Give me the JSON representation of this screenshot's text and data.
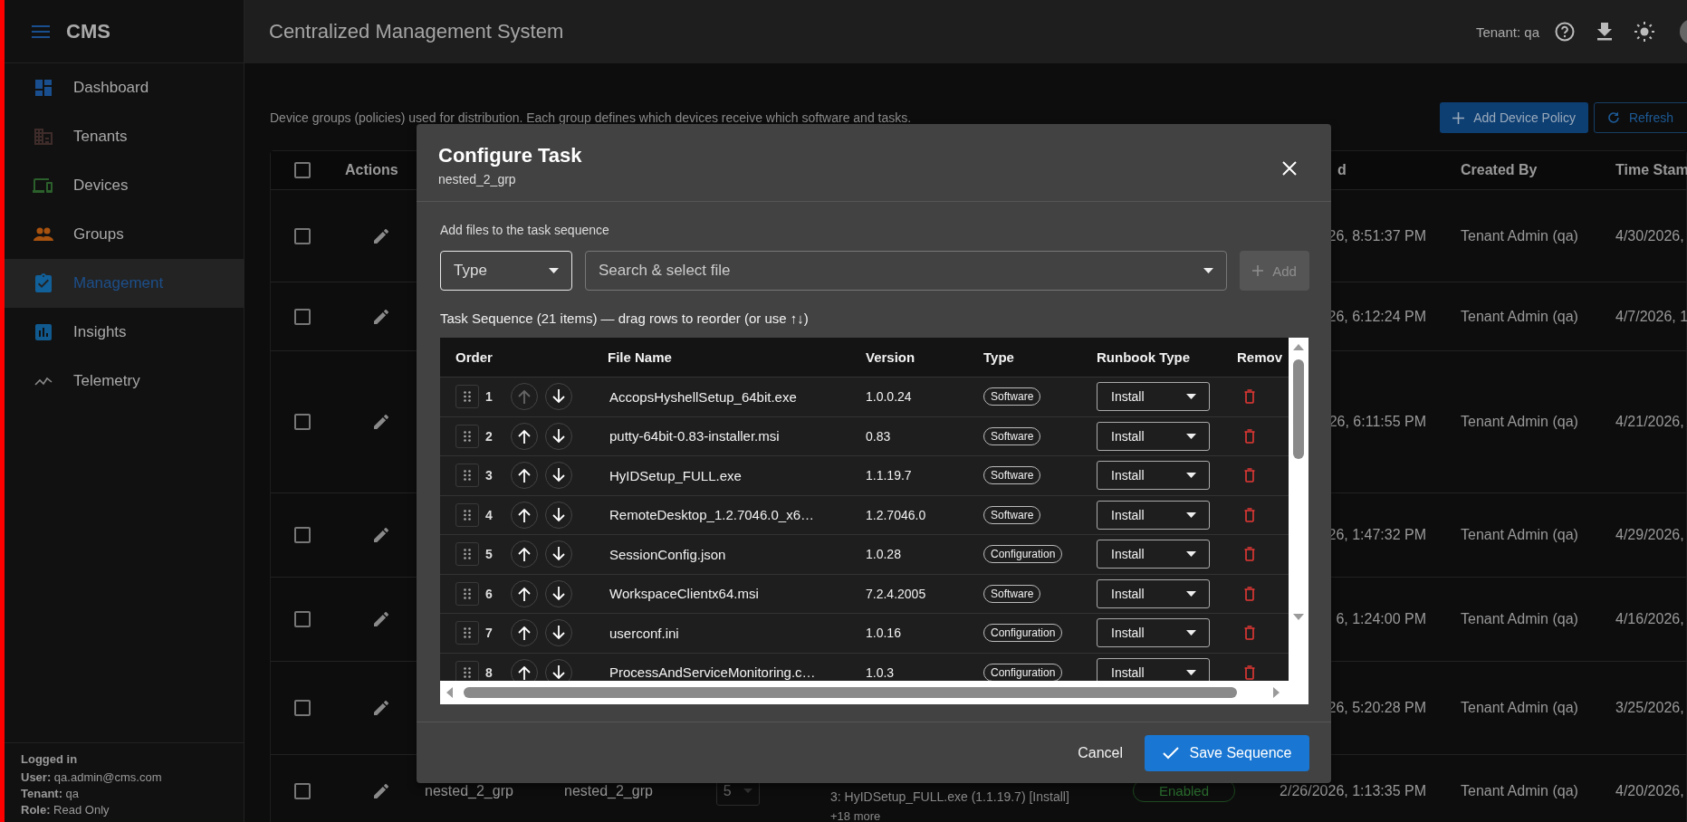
{
  "sidebar": {
    "brand": "CMS",
    "items": [
      {
        "label": "Dashboard",
        "selected": false,
        "color": "#1a4f8f"
      },
      {
        "label": "Tenants",
        "selected": false,
        "color": "#3e2c2a"
      },
      {
        "label": "Devices",
        "selected": false,
        "color": "#2b5f2b"
      },
      {
        "label": "Groups",
        "selected": false,
        "color": "#a8520f"
      },
      {
        "label": "Management",
        "selected": true,
        "color": "#11609a"
      },
      {
        "label": "Insights",
        "selected": false,
        "color": "#115a8f"
      },
      {
        "label": "Telemetry",
        "selected": false,
        "color": "#8a8a8a"
      }
    ],
    "logged_in": {
      "heading": "Logged in",
      "lines": [
        "**User:** qa.admin@cms.com",
        "**Tenant:** qa",
        "**Role:** Read Only"
      ]
    }
  },
  "header": {
    "title": "Centralized Management System",
    "tenant": "Tenant: qa"
  },
  "page": {
    "description": "Device groups (policies) used for distribution. Each group defines which devices receive which software and tasks.",
    "buttons": [
      {
        "label": "Add Device Policy",
        "kind": "primary"
      },
      {
        "label": "Refresh",
        "kind": "outlined"
      }
    ]
  },
  "policies_table": {
    "header_checked": false,
    "columns": {
      "actions": "Actions",
      "column_8": "d",
      "created_by": "Created By",
      "time_stamp": "Time Stam"
    },
    "rows": [
      {
        "checked": false,
        "column_8": "26, 8:51:37 PM",
        "created_by": "Tenant Admin (qa)",
        "time_stamp": "4/30/2026,"
      },
      {
        "checked": false,
        "column_8": "26, 6:12:24 PM",
        "created_by": "Tenant Admin (qa)",
        "time_stamp": "4/7/2026, 1"
      },
      {
        "checked": false,
        "column_8": "26, 6:11:55 PM",
        "created_by": "Tenant Admin (qa)",
        "time_stamp": "4/21/2026,"
      },
      {
        "checked": false,
        "column_8": "26, 1:47:32 PM",
        "created_by": "Tenant Admin (qa)",
        "time_stamp": "4/29/2026,"
      },
      {
        "checked": false,
        "column_8": "6, 1:24:00 PM",
        "created_by": "Tenant Admin (qa)",
        "time_stamp": "4/16/2026,"
      },
      {
        "checked": false,
        "column_8": "26, 5:20:28 PM",
        "created_by": "Tenant Admin (qa)",
        "time_stamp": "3/25/2026,"
      },
      {
        "checked": false,
        "column_3": "nested_2_grp",
        "column_4": "nested_2_grp",
        "column_5": "5",
        "column_6": [
          "3: HyIDSetup_FULL.exe (1.1.19.7) [Install]",
          "+18 more"
        ],
        "column_7": "Enabled",
        "column_8": "2/26/2026, 1:13:35 PM",
        "created_by": "Tenant Admin (qa)",
        "time_stamp": "4/20/2026,"
      }
    ]
  },
  "dialog": {
    "title": "Configure Task",
    "subtitle": "nested_2_grp",
    "add_files": {
      "label": "Add files to the task sequence",
      "type_select": {
        "placeholder": "Type"
      },
      "file_select": {
        "placeholder": "Search & select file"
      },
      "add_button": {
        "label": "Add",
        "disabled": true
      }
    },
    "task_sequence": {
      "heading": "Task Sequence (21 items) — drag rows to reorder (or use ↑↓)",
      "columns": [
        "Order",
        "File Name",
        "Version",
        "Type",
        "Runbook Type",
        "Remov"
      ],
      "rows": [
        {
          "order": "1",
          "file": "AccopsHyshellSetup_64bit.exe",
          "version": "1.0.0.24",
          "type": "Software",
          "runbook": "Install",
          "up_disabled": true
        },
        {
          "order": "2",
          "file": "putty-64bit-0.83-installer.msi",
          "version": "0.83",
          "type": "Software",
          "runbook": "Install",
          "up_disabled": false
        },
        {
          "order": "3",
          "file": "HyIDSetup_FULL.exe",
          "version": "1.1.19.7",
          "type": "Software",
          "runbook": "Install",
          "up_disabled": false
        },
        {
          "order": "4",
          "file": "RemoteDesktop_1.2.7046.0_x6…",
          "version": "1.2.7046.0",
          "type": "Software",
          "runbook": "Install",
          "up_disabled": false
        },
        {
          "order": "5",
          "file": "SessionConfig.json",
          "version": "1.0.28",
          "type": "Configuration",
          "runbook": "Install",
          "up_disabled": false
        },
        {
          "order": "6",
          "file": "WorkspaceClientx64.msi",
          "version": "7.2.4.2005",
          "type": "Software",
          "runbook": "Install",
          "up_disabled": false
        },
        {
          "order": "7",
          "file": "userconf.ini",
          "version": "1.0.16",
          "type": "Configuration",
          "runbook": "Install",
          "up_disabled": false
        },
        {
          "order": "8",
          "file": "ProcessAndServiceMonitoring.c…",
          "version": "1.0.3",
          "type": "Configuration",
          "runbook": "Install",
          "up_disabled": false
        }
      ]
    },
    "buttons": {
      "cancel": "Cancel",
      "save": "Save Sequence"
    }
  }
}
